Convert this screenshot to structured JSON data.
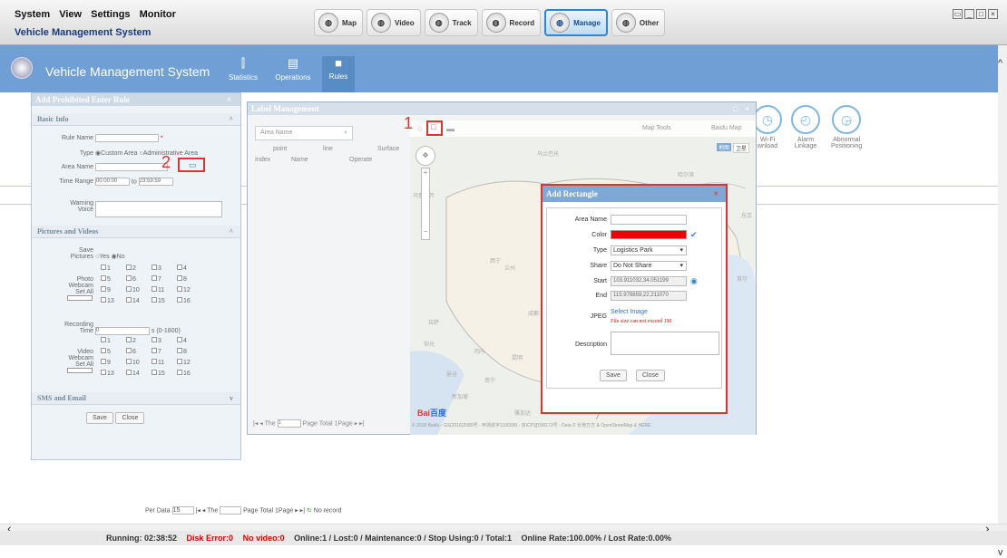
{
  "menu": {
    "system": "System",
    "view": "View",
    "settings": "Settings",
    "monitor": "Monitor"
  },
  "app_title": "Vehicle Management System",
  "modules": [
    {
      "label": "Map"
    },
    {
      "label": "Video"
    },
    {
      "label": "Track"
    },
    {
      "label": "Record"
    },
    {
      "label": "Manage"
    },
    {
      "label": "Other"
    }
  ],
  "header": {
    "title": "Vehicle Management System",
    "tabs": [
      {
        "label": "Statistics"
      },
      {
        "label": "Operations"
      },
      {
        "label": "Rules"
      }
    ]
  },
  "features": [
    {
      "label": "Wi-Fi",
      "label2": "wnload"
    },
    {
      "label": "Alarm",
      "label2": "Linkage"
    },
    {
      "label": "Abnormal",
      "label2": "Positioning"
    }
  ],
  "annotations": {
    "one": "1",
    "two": "2"
  },
  "left_dialog": {
    "title": "Add  Prohibited Enter Rule",
    "basic_info": "Basic Info",
    "rule_name": "Rule Name",
    "type": "Type",
    "custom_area": "Custom Area",
    "admin_area": "Administrative Area",
    "area_name": "Area Name",
    "time_range": "Time Range",
    "time_from": "00:00:00",
    "to": "to",
    "time_to": "23:59:59",
    "warning_voice": "Warning Voice",
    "pictures_videos": "Pictures and Videos",
    "save_pictures": "Save Pictures",
    "yes": "Yes",
    "no": "No",
    "photo_webcam": "Photo Webcam",
    "set_all": "Set All",
    "cams": [
      "1",
      "2",
      "3",
      "4",
      "5",
      "6",
      "7",
      "8",
      "9",
      "10",
      "11",
      "12",
      "13",
      "14",
      "15",
      "16"
    ],
    "recording_time": "Recording Time",
    "rec_val": "0",
    "rec_range": "s (0-1800)",
    "video_webcam": "Video Webcam",
    "sms_email": "SMS and Email",
    "save": "Save",
    "close": "Close",
    "asterisk": "*"
  },
  "label_mgmt": {
    "title": "Label Management",
    "search_placeholder": "Area Name",
    "tabs": {
      "point": "point",
      "line": "line",
      "surface": "Surface"
    },
    "cols": {
      "index": "Index",
      "name": "Name",
      "operate": "Operate"
    },
    "pager": {
      "the": "The",
      "page_val": "1",
      "page_total": "Page Total 1Page"
    },
    "map_tools": "Map Tools",
    "baidu_map": "Baidu Map",
    "map_tabs": {
      "map": "地图",
      "sat": "卫星"
    },
    "copyright": "© 2018 Baidu - GS(2016)2089号 - 甲测资字1100930 - 京ICP证030173号 - Data © 长地万方 &  OpenStreetMap  &  HERE",
    "baidu_logo": "Bai",
    "baidu_logo2": "百度"
  },
  "map_labels": [
    "乌兰巴托",
    "哈尔滨",
    "乌鲁木齐",
    "西宁",
    "兰州",
    "成都",
    "拉萨",
    "昆明",
    "香港",
    "大连",
    "首尔",
    "东京",
    "南宁",
    "曼谷",
    "仰光",
    "河内",
    "雅加达",
    "新加坡"
  ],
  "add_rect": {
    "title": "Add Rectangle",
    "area_name": "Area Name",
    "color": "Color",
    "color_value": "#ee0000",
    "type": "Type",
    "type_value": "Logistics Park",
    "share": "Share",
    "share_value": "Do Not Share",
    "start": "Start",
    "start_value": "103.911032,34.051199",
    "end": "End",
    "end_value": "115.979859,22.211070",
    "jpeg": "JPEG",
    "select_image": "Select Image",
    "file_note": "File size can not exceed 1M",
    "description": "Description",
    "save": "Save",
    "close": "Close"
  },
  "bottom_pager": {
    "per_data": "Per Data",
    "per_val": "15",
    "the": "The",
    "page_total": "Page Total 1Page",
    "no_record": "No record"
  },
  "status": {
    "running": "Running: 02:38:52",
    "disk": "Disk Error:0",
    "novideo": "No video:0",
    "online": "Online:1 / Lost:0 / Maintenance:0 / Stop Using:0 / Total:1",
    "rate": "Online Rate:100.00% / Lost Rate:0.00%"
  },
  "colors": {
    "accent": "#2a86d8",
    "header_blue": "#6f9fd4",
    "highlight": "#e5322d"
  }
}
